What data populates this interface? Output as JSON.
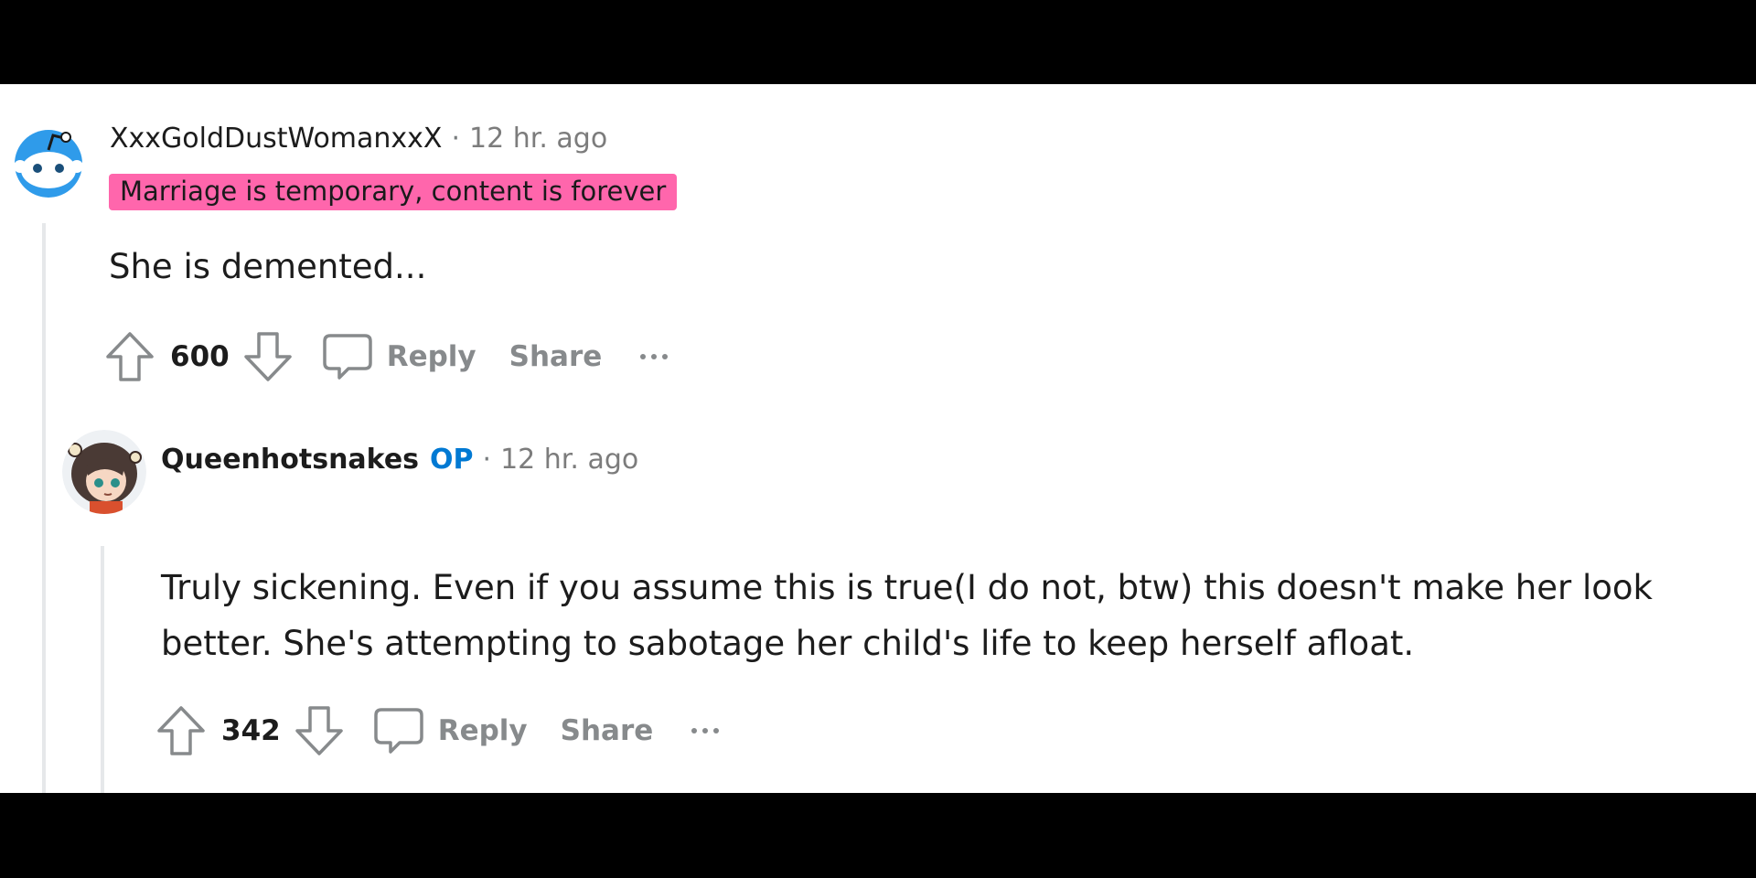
{
  "comments": [
    {
      "username": "XxxGoldDustWomanxxX",
      "separator": "·",
      "time": "12 hr. ago",
      "flair": "Marriage is temporary, content is forever",
      "body": "She is demented...",
      "score": "600",
      "reply_label": "Reply",
      "share_label": "Share"
    },
    {
      "username": "Queenhotsnakes",
      "op_badge": "OP",
      "separator": "·",
      "time": "12 hr. ago",
      "body": "Truly sickening. Even if you assume this is true(I do not, btw) this doesn't make her look better. She's attempting to sabotage her child's life to keep herself afloat.",
      "score": "342",
      "reply_label": "Reply",
      "share_label": "Share"
    }
  ],
  "colors": {
    "flair_bg": "#ff66ac",
    "op_badge": "#0079d3",
    "muted": "#878a8c",
    "avatar_blue": "#2f9bea"
  },
  "icons": [
    "reddit-snoo-avatar",
    "anime-avatar",
    "upvote-icon",
    "downvote-icon",
    "comment-icon",
    "more-options-icon"
  ]
}
